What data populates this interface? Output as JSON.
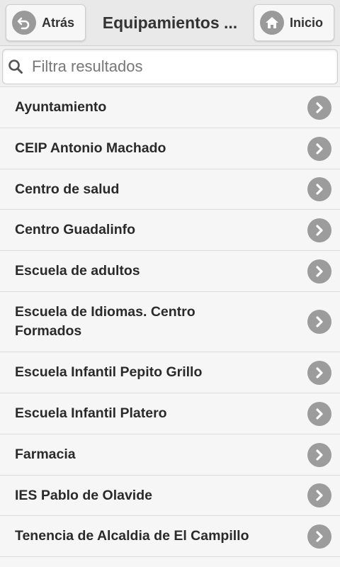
{
  "header": {
    "back_label": "Atrás",
    "title": "Equipamientos ...",
    "home_label": "Inicio"
  },
  "search": {
    "placeholder": "Filtra resultados",
    "value": ""
  },
  "items": [
    {
      "label": "Ayuntamiento"
    },
    {
      "label": "CEIP Antonio Machado"
    },
    {
      "label": "Centro de salud"
    },
    {
      "label": "Centro Guadalinfo"
    },
    {
      "label": "Escuela de adultos"
    },
    {
      "label": "Escuela de Idiomas. Centro Formados"
    },
    {
      "label": "Escuela Infantil Pepito Grillo"
    },
    {
      "label": "Escuela Infantil Platero"
    },
    {
      "label": "Farmacia"
    },
    {
      "label": "IES Pablo de Olavide"
    },
    {
      "label": "Tenencia de Alcaldia de El Campillo"
    }
  ],
  "colors": {
    "icon_gray": "#9c9c9c",
    "header_bg": "#e9e9e9",
    "list_bg": "#f6f6f6"
  }
}
